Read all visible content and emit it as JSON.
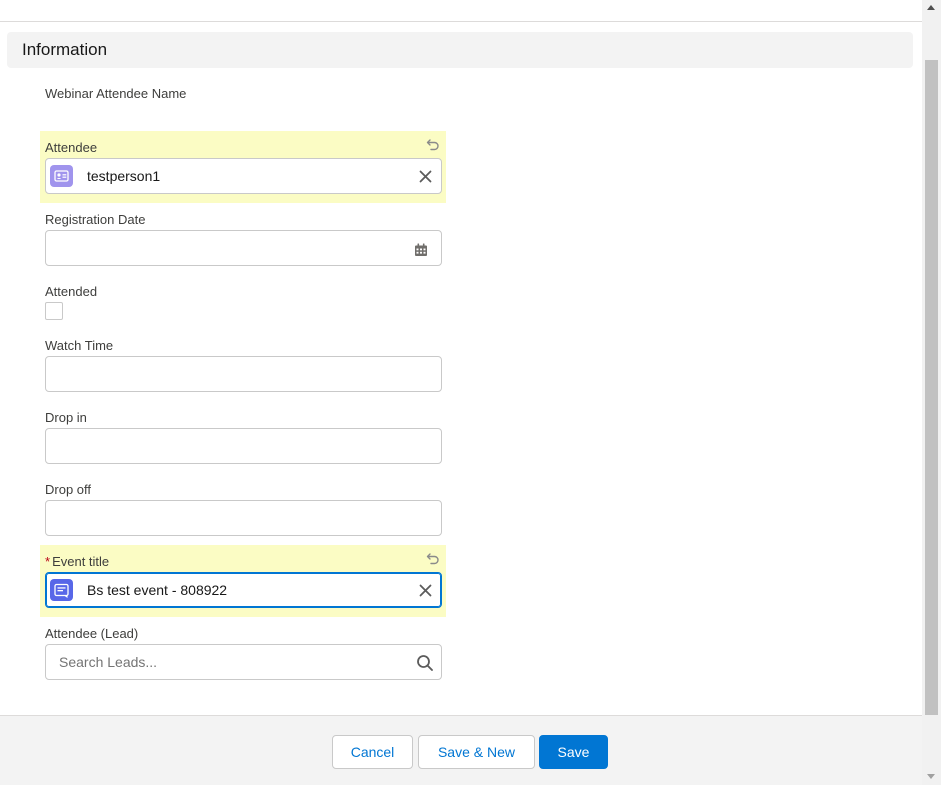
{
  "section": {
    "title": "Information"
  },
  "fields": {
    "name": {
      "label": "Webinar Attendee Name"
    },
    "attendee": {
      "label": "Attendee",
      "value": "testperson1",
      "icon": "contact-card-icon"
    },
    "registration_date": {
      "label": "Registration Date",
      "value": ""
    },
    "attended": {
      "label": "Attended",
      "checked": false
    },
    "watch_time": {
      "label": "Watch Time",
      "value": ""
    },
    "drop_in": {
      "label": "Drop in",
      "value": ""
    },
    "drop_off": {
      "label": "Drop off",
      "value": ""
    },
    "event_title": {
      "label": "Event title",
      "required_marker": "*",
      "value": "Bs test event - 808922",
      "icon": "event-record-icon"
    },
    "attendee_lead": {
      "label": "Attendee (Lead)",
      "placeholder": "Search Leads..."
    }
  },
  "footer": {
    "cancel_label": "Cancel",
    "save_new_label": "Save & New",
    "save_label": "Save"
  },
  "colors": {
    "brand": "#0176d3",
    "highlight": "#fbfcc4",
    "attendee_icon_bg": "#a094ed",
    "event_icon_bg": "#5867e8",
    "required": "#ba0517"
  }
}
